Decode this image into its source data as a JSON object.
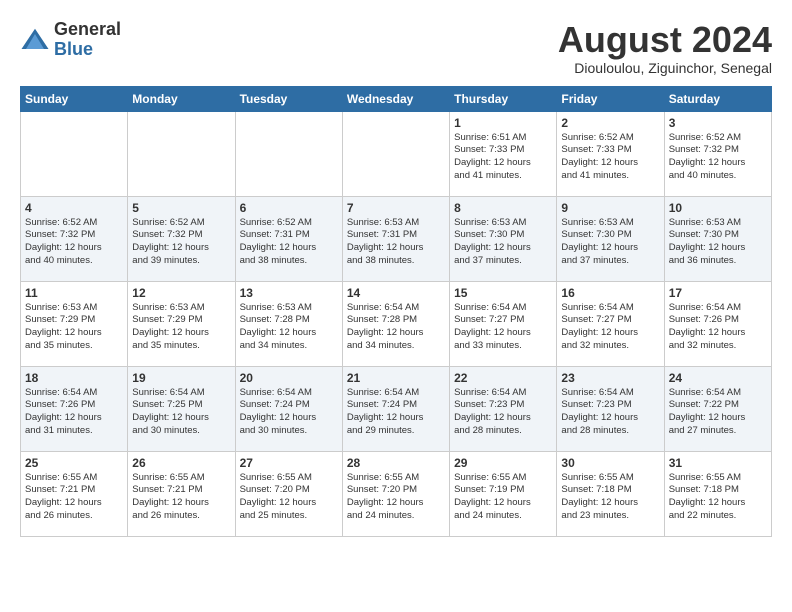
{
  "logo": {
    "general": "General",
    "blue": "Blue"
  },
  "title": "August 2024",
  "subtitle": "Diouloulou, Ziguinchor, Senegal",
  "days_of_week": [
    "Sunday",
    "Monday",
    "Tuesday",
    "Wednesday",
    "Thursday",
    "Friday",
    "Saturday"
  ],
  "weeks": [
    [
      {
        "day": "",
        "detail": ""
      },
      {
        "day": "",
        "detail": ""
      },
      {
        "day": "",
        "detail": ""
      },
      {
        "day": "",
        "detail": ""
      },
      {
        "day": "1",
        "detail": "Sunrise: 6:51 AM\nSunset: 7:33 PM\nDaylight: 12 hours\nand 41 minutes."
      },
      {
        "day": "2",
        "detail": "Sunrise: 6:52 AM\nSunset: 7:33 PM\nDaylight: 12 hours\nand 41 minutes."
      },
      {
        "day": "3",
        "detail": "Sunrise: 6:52 AM\nSunset: 7:32 PM\nDaylight: 12 hours\nand 40 minutes."
      }
    ],
    [
      {
        "day": "4",
        "detail": "Sunrise: 6:52 AM\nSunset: 7:32 PM\nDaylight: 12 hours\nand 40 minutes."
      },
      {
        "day": "5",
        "detail": "Sunrise: 6:52 AM\nSunset: 7:32 PM\nDaylight: 12 hours\nand 39 minutes."
      },
      {
        "day": "6",
        "detail": "Sunrise: 6:52 AM\nSunset: 7:31 PM\nDaylight: 12 hours\nand 38 minutes."
      },
      {
        "day": "7",
        "detail": "Sunrise: 6:53 AM\nSunset: 7:31 PM\nDaylight: 12 hours\nand 38 minutes."
      },
      {
        "day": "8",
        "detail": "Sunrise: 6:53 AM\nSunset: 7:30 PM\nDaylight: 12 hours\nand 37 minutes."
      },
      {
        "day": "9",
        "detail": "Sunrise: 6:53 AM\nSunset: 7:30 PM\nDaylight: 12 hours\nand 37 minutes."
      },
      {
        "day": "10",
        "detail": "Sunrise: 6:53 AM\nSunset: 7:30 PM\nDaylight: 12 hours\nand 36 minutes."
      }
    ],
    [
      {
        "day": "11",
        "detail": "Sunrise: 6:53 AM\nSunset: 7:29 PM\nDaylight: 12 hours\nand 35 minutes."
      },
      {
        "day": "12",
        "detail": "Sunrise: 6:53 AM\nSunset: 7:29 PM\nDaylight: 12 hours\nand 35 minutes."
      },
      {
        "day": "13",
        "detail": "Sunrise: 6:53 AM\nSunset: 7:28 PM\nDaylight: 12 hours\nand 34 minutes."
      },
      {
        "day": "14",
        "detail": "Sunrise: 6:54 AM\nSunset: 7:28 PM\nDaylight: 12 hours\nand 34 minutes."
      },
      {
        "day": "15",
        "detail": "Sunrise: 6:54 AM\nSunset: 7:27 PM\nDaylight: 12 hours\nand 33 minutes."
      },
      {
        "day": "16",
        "detail": "Sunrise: 6:54 AM\nSunset: 7:27 PM\nDaylight: 12 hours\nand 32 minutes."
      },
      {
        "day": "17",
        "detail": "Sunrise: 6:54 AM\nSunset: 7:26 PM\nDaylight: 12 hours\nand 32 minutes."
      }
    ],
    [
      {
        "day": "18",
        "detail": "Sunrise: 6:54 AM\nSunset: 7:26 PM\nDaylight: 12 hours\nand 31 minutes."
      },
      {
        "day": "19",
        "detail": "Sunrise: 6:54 AM\nSunset: 7:25 PM\nDaylight: 12 hours\nand 30 minutes."
      },
      {
        "day": "20",
        "detail": "Sunrise: 6:54 AM\nSunset: 7:24 PM\nDaylight: 12 hours\nand 30 minutes."
      },
      {
        "day": "21",
        "detail": "Sunrise: 6:54 AM\nSunset: 7:24 PM\nDaylight: 12 hours\nand 29 minutes."
      },
      {
        "day": "22",
        "detail": "Sunrise: 6:54 AM\nSunset: 7:23 PM\nDaylight: 12 hours\nand 28 minutes."
      },
      {
        "day": "23",
        "detail": "Sunrise: 6:54 AM\nSunset: 7:23 PM\nDaylight: 12 hours\nand 28 minutes."
      },
      {
        "day": "24",
        "detail": "Sunrise: 6:54 AM\nSunset: 7:22 PM\nDaylight: 12 hours\nand 27 minutes."
      }
    ],
    [
      {
        "day": "25",
        "detail": "Sunrise: 6:55 AM\nSunset: 7:21 PM\nDaylight: 12 hours\nand 26 minutes."
      },
      {
        "day": "26",
        "detail": "Sunrise: 6:55 AM\nSunset: 7:21 PM\nDaylight: 12 hours\nand 26 minutes."
      },
      {
        "day": "27",
        "detail": "Sunrise: 6:55 AM\nSunset: 7:20 PM\nDaylight: 12 hours\nand 25 minutes."
      },
      {
        "day": "28",
        "detail": "Sunrise: 6:55 AM\nSunset: 7:20 PM\nDaylight: 12 hours\nand 24 minutes."
      },
      {
        "day": "29",
        "detail": "Sunrise: 6:55 AM\nSunset: 7:19 PM\nDaylight: 12 hours\nand 24 minutes."
      },
      {
        "day": "30",
        "detail": "Sunrise: 6:55 AM\nSunset: 7:18 PM\nDaylight: 12 hours\nand 23 minutes."
      },
      {
        "day": "31",
        "detail": "Sunrise: 6:55 AM\nSunset: 7:18 PM\nDaylight: 12 hours\nand 22 minutes."
      }
    ]
  ]
}
